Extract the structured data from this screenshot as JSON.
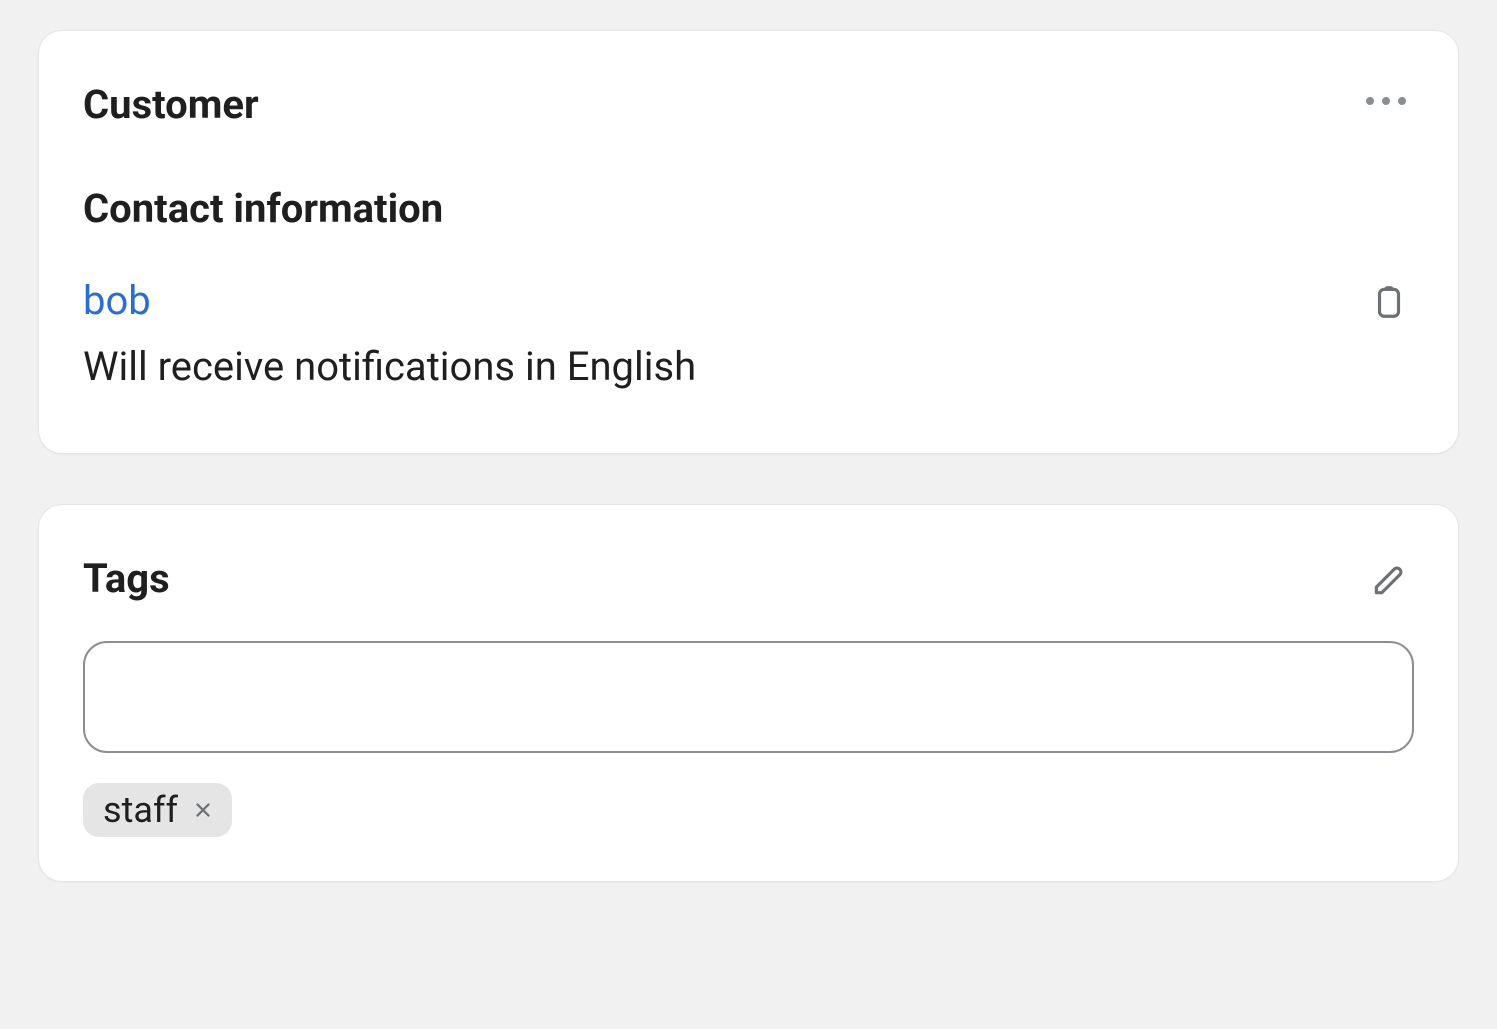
{
  "customer_card": {
    "title": "Customer",
    "contact_section_title": "Contact information",
    "contact_name": "bob",
    "notification_text": "Will receive notifications in English"
  },
  "tags_card": {
    "title": "Tags",
    "input_value": "",
    "tags": [
      {
        "label": "staff"
      }
    ]
  }
}
